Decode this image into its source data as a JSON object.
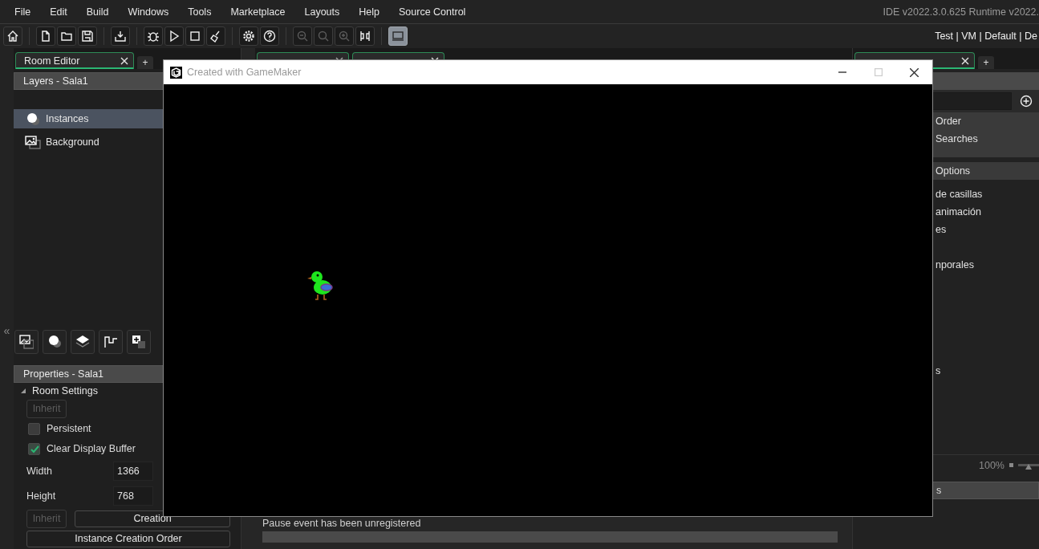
{
  "menu": [
    "File",
    "Edit",
    "Build",
    "Windows",
    "Tools",
    "Marketplace",
    "Layouts",
    "Help",
    "Source Control"
  ],
  "version": "IDE v2022.3.0.625  Runtime v2022.",
  "toolbar": [
    {
      "buttons": [
        {
          "kind": "home",
          "disabled": false,
          "on": false
        }
      ]
    },
    {
      "buttons": [
        {
          "kind": "new",
          "disabled": false,
          "on": false
        },
        {
          "kind": "open",
          "disabled": false,
          "on": false
        },
        {
          "kind": "save",
          "disabled": false,
          "on": false
        }
      ]
    },
    {
      "buttons": [
        {
          "kind": "export",
          "disabled": false,
          "on": false
        }
      ]
    },
    {
      "buttons": [
        {
          "kind": "debug",
          "disabled": false,
          "on": false
        },
        {
          "kind": "run",
          "disabled": false,
          "on": false
        },
        {
          "kind": "stop",
          "disabled": false,
          "on": false
        },
        {
          "kind": "clean",
          "disabled": false,
          "on": false
        }
      ]
    },
    {
      "buttons": [
        {
          "kind": "settings",
          "disabled": false,
          "on": false
        },
        {
          "kind": "help",
          "disabled": false,
          "on": false
        }
      ]
    },
    {
      "buttons": [
        {
          "kind": "zoomout",
          "disabled": true,
          "on": false
        },
        {
          "kind": "zoomreset",
          "disabled": true,
          "on": false
        },
        {
          "kind": "zoomin",
          "disabled": true,
          "on": false
        },
        {
          "kind": "layout",
          "disabled": false,
          "on": false
        }
      ]
    },
    {
      "buttons": [
        {
          "kind": "screen",
          "disabled": false,
          "on": true
        }
      ]
    }
  ],
  "target": "Test | VM | Default | De",
  "collapse": "«",
  "left_panel": {
    "tab": "Room Editor",
    "tab_add": "+",
    "layers_title": "Layers - Sala1",
    "layers": [
      {
        "kind": "instances",
        "label": "Instances",
        "selected": true
      },
      {
        "kind": "background",
        "label": "Background",
        "selected": false
      }
    ],
    "properties_title": "Properties - Sala1",
    "section": {
      "label": "Room Settings",
      "expanded": true
    },
    "inherit_1": {
      "label": "Inherit",
      "disabled": true
    },
    "checks": [
      {
        "label": "Persistent",
        "checked": false
      },
      {
        "label": "Clear Display Buffer",
        "checked": true
      }
    ],
    "fields": [
      {
        "label": "Width",
        "value": "1366"
      },
      {
        "label": "Height",
        "value": "768"
      }
    ],
    "inherit_2": {
      "label": "Inherit",
      "disabled": true
    },
    "creation_code": "Creation",
    "instance_order": "Instance Creation Order"
  },
  "center": {
    "output_line": "Pause event has been unregistered"
  },
  "right_panel": {
    "tab_add": "+",
    "header_rows": [
      "Order",
      "Searches"
    ],
    "options": "Options",
    "items": [
      {
        "kind": "text",
        "label": "de casillas"
      },
      {
        "kind": "text",
        "label": "animación"
      },
      {
        "kind": "text",
        "label": "es"
      },
      {
        "kind": "spacer"
      },
      {
        "kind": "text",
        "label": "nporales"
      },
      {
        "kind": "spacer"
      },
      {
        "kind": "spacer"
      },
      {
        "kind": "spacer"
      },
      {
        "kind": "spacer"
      },
      {
        "kind": "spacer"
      },
      {
        "kind": "text",
        "label": "s"
      }
    ],
    "zoom": "100%",
    "zoom_slider": {
      "level": 0.5
    },
    "bottom_header": "s"
  },
  "game_window": {
    "title": "Created with GameMaker"
  }
}
